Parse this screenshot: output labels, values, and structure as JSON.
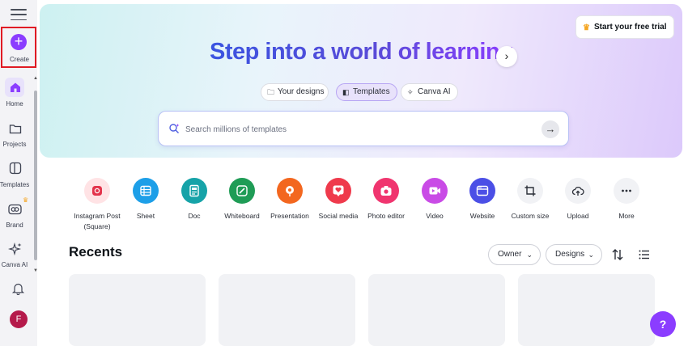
{
  "sidebar": {
    "create_label": "Create",
    "items": [
      {
        "label": "Home",
        "icon": "home-icon"
      },
      {
        "label": "Projects",
        "icon": "folder-icon"
      },
      {
        "label": "Templates",
        "icon": "templates-icon"
      },
      {
        "label": "Brand",
        "icon": "brand-icon"
      },
      {
        "label": "Canva AI",
        "icon": "sparkle-icon"
      }
    ],
    "notification_icon": "bell-icon",
    "avatar_initial": "F"
  },
  "header": {
    "trial_button": "Start your free trial"
  },
  "hero": {
    "title": "Step into a world of learning",
    "pills": [
      "Your designs",
      "Templates",
      "Canva AI"
    ],
    "active_pill": "Templates"
  },
  "search": {
    "placeholder": "Search millions of templates"
  },
  "tools": [
    {
      "label": "Instagram Post (Square)",
      "icon": "instagram-icon",
      "color": "#ffe3e5",
      "fg": "#e3334b"
    },
    {
      "label": "Sheet",
      "icon": "sheet-icon",
      "color": "#1d9fe8",
      "fg": "#ffffff"
    },
    {
      "label": "Doc",
      "icon": "doc-icon",
      "color": "#16a3a8",
      "fg": "#ffffff"
    },
    {
      "label": "Whiteboard",
      "icon": "whiteboard-icon",
      "color": "#1f9c56",
      "fg": "#ffffff"
    },
    {
      "label": "Presentation",
      "icon": "presentation-icon",
      "color": "#f3671f",
      "fg": "#ffffff"
    },
    {
      "label": "Social media",
      "icon": "heart-icon",
      "color": "#ef3a4c",
      "fg": "#ffffff"
    },
    {
      "label": "Photo editor",
      "icon": "camera-icon",
      "color": "#f0356f",
      "fg": "#ffffff"
    },
    {
      "label": "Video",
      "icon": "video-icon",
      "color": "#c94be6",
      "fg": "#ffffff"
    },
    {
      "label": "Website",
      "icon": "website-icon",
      "color": "#4b4fe6",
      "fg": "#ffffff"
    },
    {
      "label": "Custom size",
      "icon": "crop-icon",
      "color": "#f1f2f5",
      "fg": "#2b2f38"
    },
    {
      "label": "Upload",
      "icon": "upload-cloud-icon",
      "color": "#f1f2f5",
      "fg": "#2b2f38"
    },
    {
      "label": "More",
      "icon": "more-icon",
      "color": "#f1f2f5",
      "fg": "#2b2f38"
    }
  ],
  "recents": {
    "title": "Recents",
    "filters": [
      "Owner",
      "Designs"
    ]
  },
  "help_label": "?",
  "colors": {
    "brand": "#8b3dff",
    "highlight_box": "#e01b24"
  }
}
